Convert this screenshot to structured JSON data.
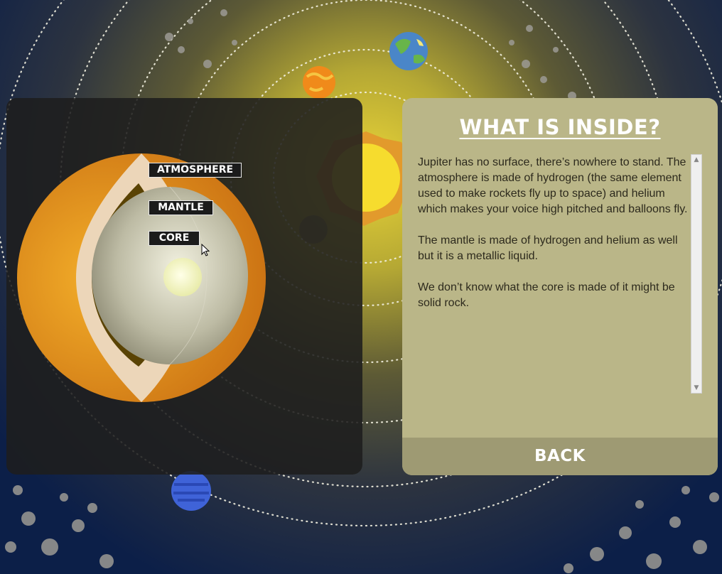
{
  "labels": {
    "atmosphere": "ATMOSPHERE",
    "mantle": "MANTLE",
    "core": "CORE"
  },
  "info": {
    "title": "WHAT IS INSIDE?",
    "paragraphs": [
      "Jupiter has no surface, there’s nowhere to stand. The atmosphere is made of hydrogen (the same element used to make rockets fly up to space) and helium which makes your voice high pitched and balloons fly.",
      "The mantle is made of hydrogen and helium as well but it is a metallic liquid.",
      "We don’t know what the core is made of it might be solid rock."
    ],
    "back_label": "BACK"
  },
  "icons": {
    "scroll_up": "▲",
    "scroll_down": "▼"
  },
  "colors": {
    "info_panel": "#bab688",
    "back_bar": "#9e9a73",
    "jupiter_orange": "#e8a020",
    "sun_yellow": "#f6dc2e"
  }
}
